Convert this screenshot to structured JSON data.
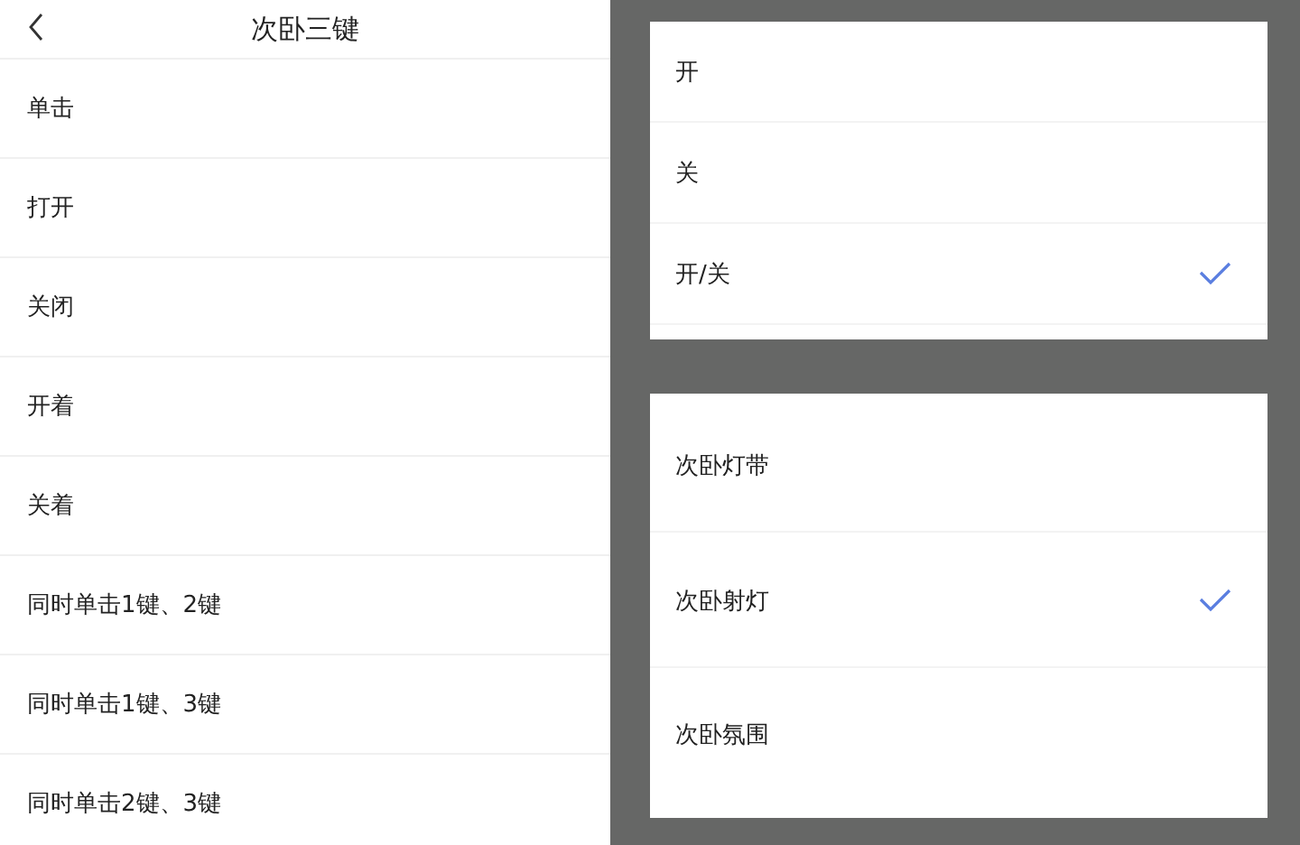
{
  "header": {
    "title": "次卧三键"
  },
  "actions": [
    {
      "label": "单击"
    },
    {
      "label": "打开"
    },
    {
      "label": "关闭"
    },
    {
      "label": "开着"
    },
    {
      "label": "关着"
    },
    {
      "label": "同时单击1键、2键"
    },
    {
      "label": "同时单击1键、3键"
    },
    {
      "label": "同时单击2键、3键"
    }
  ],
  "mode_picker": [
    {
      "label": "开",
      "selected": false
    },
    {
      "label": "关",
      "selected": false
    },
    {
      "label": "开/关",
      "selected": true
    }
  ],
  "device_picker": [
    {
      "label": "次卧灯带",
      "selected": false
    },
    {
      "label": "次卧射灯",
      "selected": true
    },
    {
      "label": "次卧氛围",
      "selected": false
    }
  ]
}
